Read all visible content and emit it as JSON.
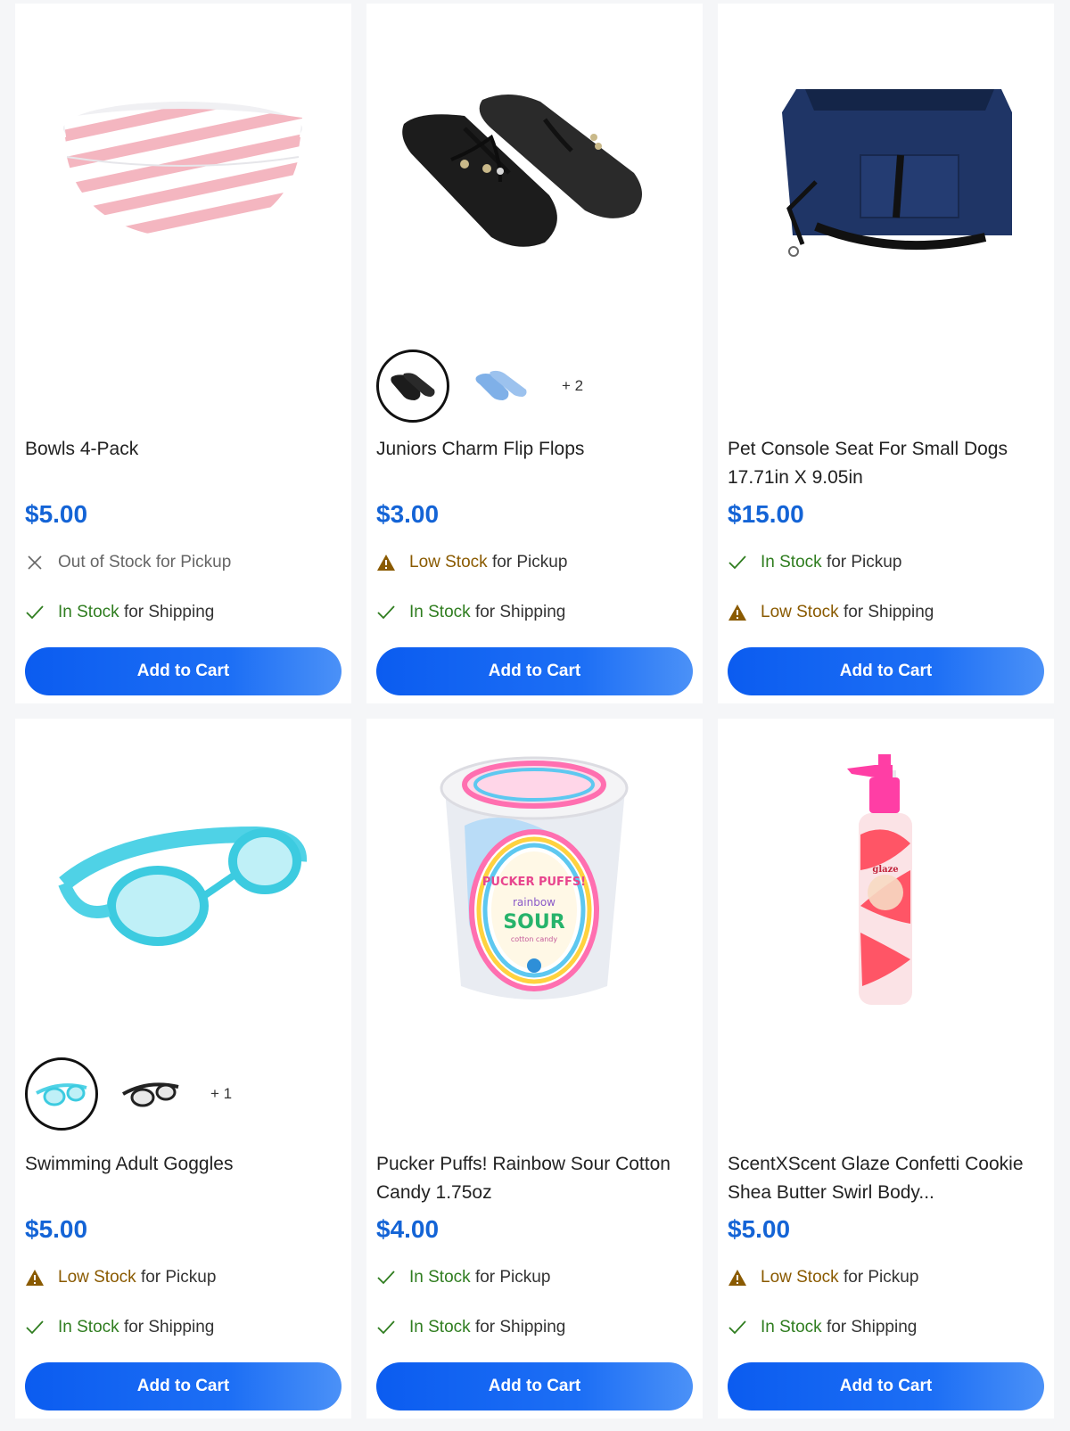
{
  "products": [
    {
      "title": "Bowls 4-Pack",
      "price": "$5.00",
      "pickup": {
        "status": "Out of Stock",
        "suffix": "for Pickup"
      },
      "shipping": {
        "status": "In Stock",
        "suffix": "for Shipping"
      },
      "cta": "Add to Cart"
    },
    {
      "title": "Juniors Charm Flip Flops",
      "price": "$3.00",
      "swatch_more": "+ 2",
      "pickup": {
        "status": "Low Stock",
        "suffix": "for Pickup"
      },
      "shipping": {
        "status": "In Stock",
        "suffix": "for Shipping"
      },
      "cta": "Add to Cart"
    },
    {
      "title": "Pet Console Seat For Small Dogs 17.71in X 9.05in",
      "price": "$15.00",
      "pickup": {
        "status": "In Stock",
        "suffix": "for Pickup"
      },
      "shipping": {
        "status": "Low Stock",
        "suffix": "for Shipping"
      },
      "cta": "Add to Cart"
    },
    {
      "title": "Swimming Adult Goggles",
      "price": "$5.00",
      "swatch_more": "+ 1",
      "pickup": {
        "status": "Low Stock",
        "suffix": "for Pickup"
      },
      "shipping": {
        "status": "In Stock",
        "suffix": "for Shipping"
      },
      "cta": "Add to Cart"
    },
    {
      "title": "Pucker Puffs! Rainbow Sour Cotton Candy 1.75oz",
      "price": "$4.00",
      "pickup": {
        "status": "In Stock",
        "suffix": "for Pickup"
      },
      "shipping": {
        "status": "In Stock",
        "suffix": "for Shipping"
      },
      "cta": "Add to Cart"
    },
    {
      "title": "ScentXScent Glaze Confetti Cookie Shea Butter Swirl Body...",
      "price": "$5.00",
      "pickup": {
        "status": "Low Stock",
        "suffix": "for Pickup"
      },
      "shipping": {
        "status": "In Stock",
        "suffix": "for Shipping"
      },
      "cta": "Add to Cart"
    }
  ],
  "image_texts": {
    "cotton_candy_brand": "PUCKER PUFFS!",
    "cotton_candy_flavor": "rainbow",
    "cotton_candy_sour": "SOUR",
    "cotton_candy_type": "cotton candy",
    "lotion_brand": "glaze"
  },
  "icons": {
    "out": "close-icon",
    "in": "check-icon",
    "low": "warning-icon"
  },
  "colors": {
    "price": "#1464d6",
    "in_stock": "#2f7d1f",
    "low_stock": "#8a5a00",
    "button": "#0b5cf0"
  }
}
